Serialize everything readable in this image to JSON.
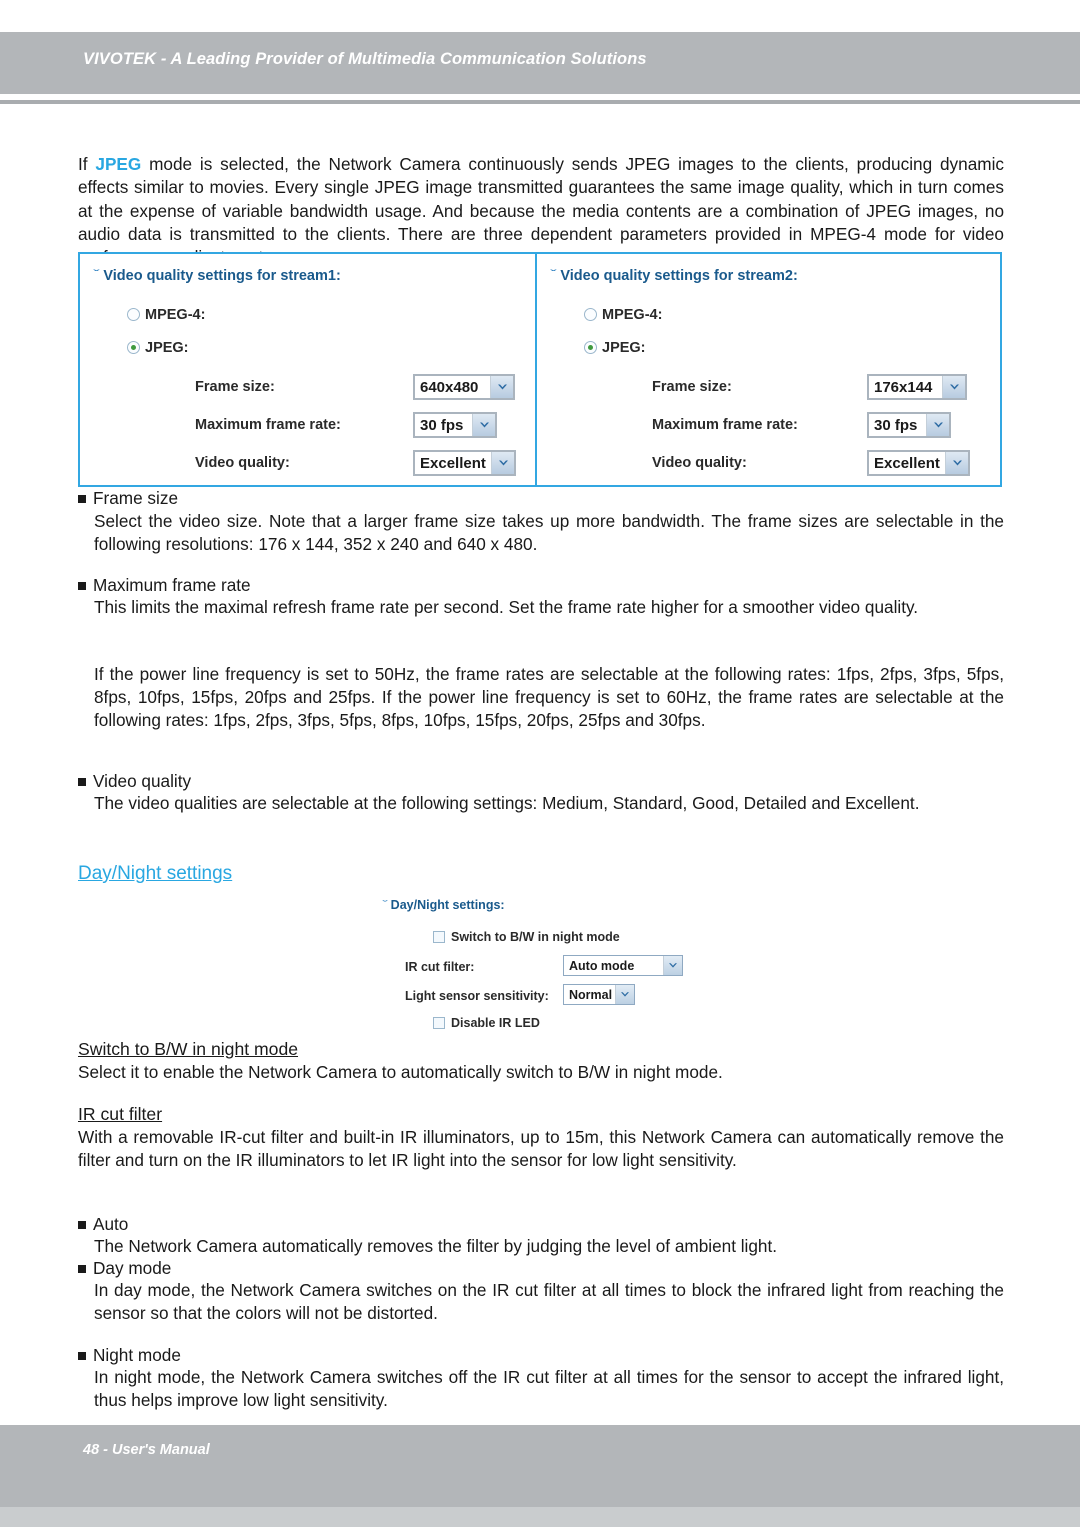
{
  "header": {
    "title": "VIVOTEK - A Leading Provider of Multimedia Communication Solutions"
  },
  "footer": {
    "page_label": "48 - User's Manual"
  },
  "intro": {
    "lead": "If ",
    "keyword": "JPEG",
    "rest": " mode is selected, the Network Camera continuously sends JPEG images to the clients, producing dynamic effects similar to movies. Every single JPEG image transmitted guarantees the same image quality, which in turn comes at the expense of variable bandwidth usage. And because the media contents are a combination of JPEG images, no audio data is transmitted to the clients. There are three dependent parameters provided in MPEG-4 mode for video performance adjustment."
  },
  "stream_panel": {
    "arrow_glyph": "ˇ",
    "columns": [
      {
        "title": "Video quality settings for stream1:",
        "radios": [
          {
            "label": "MPEG-4:",
            "checked": false
          },
          {
            "label": "JPEG:",
            "checked": true
          }
        ],
        "fields": [
          {
            "label": "Frame size:",
            "value": "640x480"
          },
          {
            "label": "Maximum frame rate:",
            "value": "30 fps"
          },
          {
            "label": "Video quality:",
            "value": "Excellent"
          }
        ]
      },
      {
        "title": "Video quality settings for stream2:",
        "radios": [
          {
            "label": "MPEG-4:",
            "checked": false
          },
          {
            "label": "JPEG:",
            "checked": true
          }
        ],
        "fields": [
          {
            "label": "Frame size:",
            "value": "176x144"
          },
          {
            "label": "Maximum frame rate:",
            "value": "30 fps"
          },
          {
            "label": "Video quality:",
            "value": "Excellent"
          }
        ]
      }
    ]
  },
  "sections": {
    "frame_size": {
      "heading": "Frame size",
      "body": "Select the video size. Note that a larger frame size takes up more bandwidth. The frame sizes are selectable in the following resolutions: 176 x 144, 352 x 240 and 640 x 480."
    },
    "max_frame_rate": {
      "heading": "Maximum frame rate",
      "body": "This limits the maximal refresh frame rate per second. Set the frame rate higher for a smoother video quality.",
      "note": "If the power line frequency is set to 50Hz, the frame rates are selectable at the following rates: 1fps, 2fps, 3fps, 5fps, 8fps, 10fps, 15fps, 20fps and 25fps. If the power line frequency is set to 60Hz, the frame rates are selectable at the following rates: 1fps, 2fps, 3fps, 5fps, 8fps, 10fps, 15fps, 20fps, 25fps and 30fps."
    },
    "video_quality": {
      "heading": "Video quality",
      "body": "The video qualities are selectable at the following settings: Medium, Standard, Good, Detailed and Excellent."
    },
    "day_night_link": "Day/Night settings",
    "switch_bw": {
      "heading": "Switch to B/W in night mode",
      "body": "Select it to enable the Network Camera to automatically switch to B/W in night mode."
    },
    "ir_cut_filter": {
      "heading": "IR cut filter",
      "body": "With a removable IR-cut filter and built-in IR illuminators, up to 15m, this Network Camera can automatically remove the filter and turn on the IR illuminators to let IR light into the sensor for low light sensitivity."
    },
    "auto": {
      "heading": "Auto",
      "body": "The Network Camera automatically removes the filter by judging the level of ambient light."
    },
    "day_mode": {
      "heading": "Day mode",
      "body": "In day mode, the Network Camera switches on the IR cut filter at all times to block the infrared light from reaching the sensor so that the colors will not be distorted."
    },
    "night_mode": {
      "heading": "Night mode",
      "body": "In night mode, the Network Camera switches off the IR cut filter at all times for the sensor to accept the infrared light, thus helps improve low light sensitivity."
    }
  },
  "day_night_panel": {
    "title": "Day/Night settings:",
    "arrow_glyph": "ˇ",
    "switch_bw_checkbox": {
      "label": "Switch to B/W in night mode",
      "checked": false
    },
    "ir_cut_filter": {
      "label": "IR cut filter:",
      "value": "Auto mode"
    },
    "light_sensor": {
      "label": "Light sensor sensitivity:",
      "value": "Normal"
    },
    "disable_ir_led": {
      "label": "Disable IR LED",
      "checked": false
    }
  },
  "colors": {
    "accent_blue": "#29a7e1",
    "panel_border": "#32a7e2",
    "header_gray": "#b3b6b9",
    "radio_selected": "#3f9a3f"
  }
}
